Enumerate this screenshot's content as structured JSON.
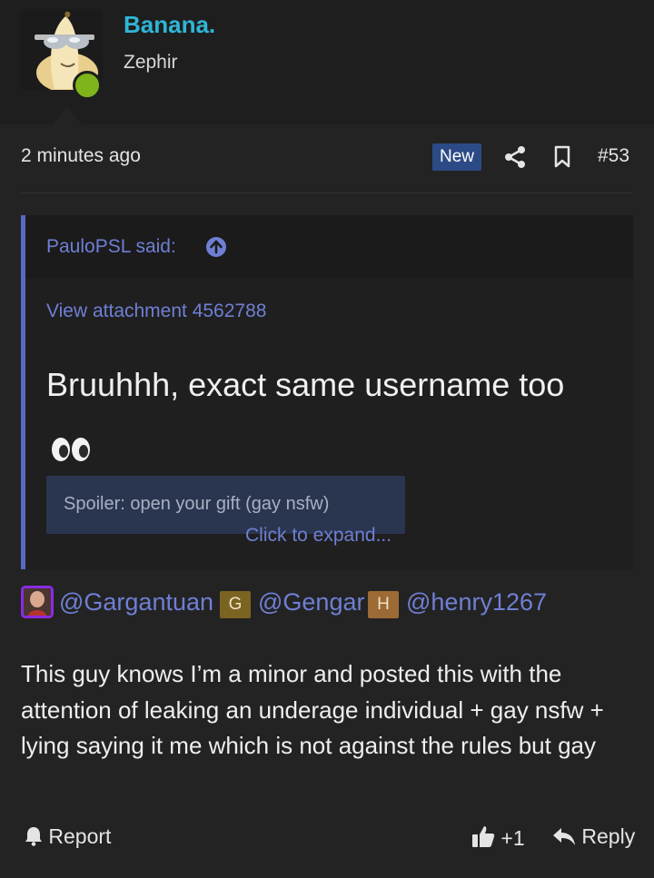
{
  "author": {
    "username": "Banana.",
    "title": "Zephir",
    "avatar_icon": "banana-sunglasses-avatar",
    "online_color": "#7fb41a"
  },
  "post_meta": {
    "time": "2 minutes ago",
    "new_badge": "New",
    "post_number": "#53",
    "icons": [
      "share-icon",
      "bookmark-icon"
    ]
  },
  "quote": {
    "author_label": "PauloPSL said:",
    "attachment_link": "View attachment 4562788",
    "text": "Bruuhhh, exact same username too",
    "emoji": "eyes-emoji",
    "spoiler_label": "Spoiler: open your gift (gay nsfw)",
    "expand_label": "Click to expand..."
  },
  "mentions": [
    {
      "avatar": "photo-avatar",
      "name": "@Gargantuan"
    },
    {
      "avatar_letter": "G",
      "color": "#7b6322",
      "name": "@Gengar"
    },
    {
      "avatar_letter": "H",
      "color": "#9c6a34",
      "name": "@henry1267"
    }
  ],
  "body": "This guy knows I’m a minor and posted this with the attention of leaking an underage individual + gay nsfw + lying saying it me which is not against the rules but gay",
  "actions": {
    "report_label": "Report",
    "reaction_count": "+1",
    "reply_label": "Reply"
  },
  "colors": {
    "accent_link": "#6f7fd4",
    "username": "#2fb6d6",
    "new_badge_bg": "#2c4a86",
    "quote_border": "#5868c4"
  }
}
